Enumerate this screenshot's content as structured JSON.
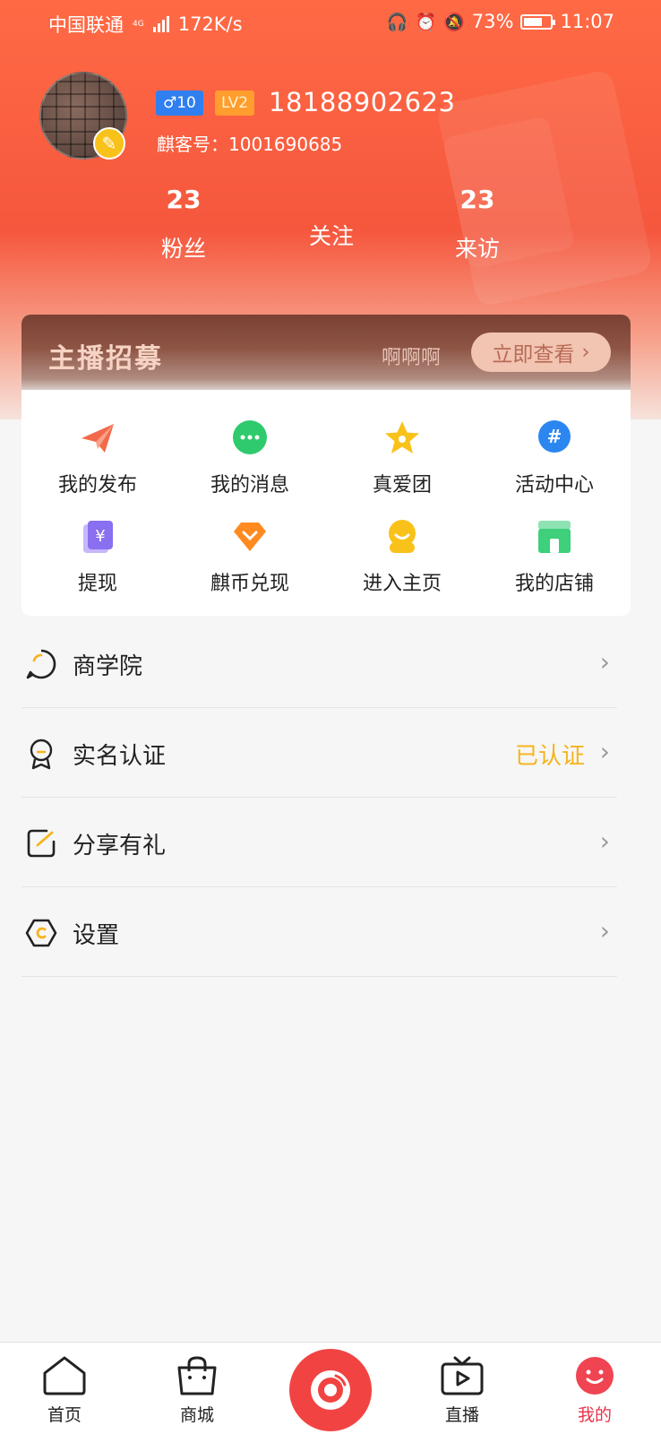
{
  "status_bar": {
    "carrier": "中国联通",
    "net_type": "4G",
    "speed": "172K/s",
    "battery_percent": "73%",
    "battery_level": 0.73,
    "time": "11:07"
  },
  "profile": {
    "gender_level": "♂10",
    "lv_badge": "LV2",
    "phone": "18188902623",
    "user_id": "麒客号：1001690685",
    "edit_icon": "pencil-icon"
  },
  "stats": {
    "fans_count": "23",
    "fans_label": "粉丝",
    "follow_label": "关注",
    "visit_count": "23",
    "visit_label": "来访"
  },
  "recruit": {
    "title": "主播招募",
    "subtitle": "啊啊啊",
    "button": "立即查看"
  },
  "grid": [
    {
      "label": "我的发布",
      "icon": "paper-plane-icon",
      "color": "#f26a4a"
    },
    {
      "label": "我的消息",
      "icon": "chat-bubble-icon",
      "color": "#2fca6d"
    },
    {
      "label": "真爱团",
      "icon": "star-icon",
      "color": "#f9c21b"
    },
    {
      "label": "活动中心",
      "icon": "hashtag-icon",
      "color": "#2b86f0"
    },
    {
      "label": "提现",
      "icon": "yuan-card-icon",
      "color": "#8a6ff0"
    },
    {
      "label": "麒币兑现",
      "icon": "diamond-icon",
      "color": "#ff8a1f"
    },
    {
      "label": "进入主页",
      "icon": "smiley-face-icon",
      "color": "#f9c21b"
    },
    {
      "label": "我的店铺",
      "icon": "storefront-icon",
      "color": "#3ed07b"
    }
  ],
  "menu": [
    {
      "label": "商学院",
      "icon": "school-bubble-icon",
      "value": ""
    },
    {
      "label": "实名认证",
      "icon": "medal-icon",
      "value": "已认证"
    },
    {
      "label": "分享有礼",
      "icon": "share-edit-icon",
      "value": ""
    },
    {
      "label": "设置",
      "icon": "hex-gear-icon",
      "value": ""
    }
  ],
  "tabs": [
    {
      "label": "首页",
      "icon": "home-icon"
    },
    {
      "label": "商城",
      "icon": "shopping-bag-icon"
    },
    {
      "label": "",
      "icon": "camera-eye-icon"
    },
    {
      "label": "直播",
      "icon": "tv-play-icon"
    },
    {
      "label": "我的",
      "icon": "profile-face-icon"
    }
  ],
  "colors": {
    "header": "#f5573d",
    "accent_red": "#e9334a",
    "verified": "#f5b41b"
  }
}
